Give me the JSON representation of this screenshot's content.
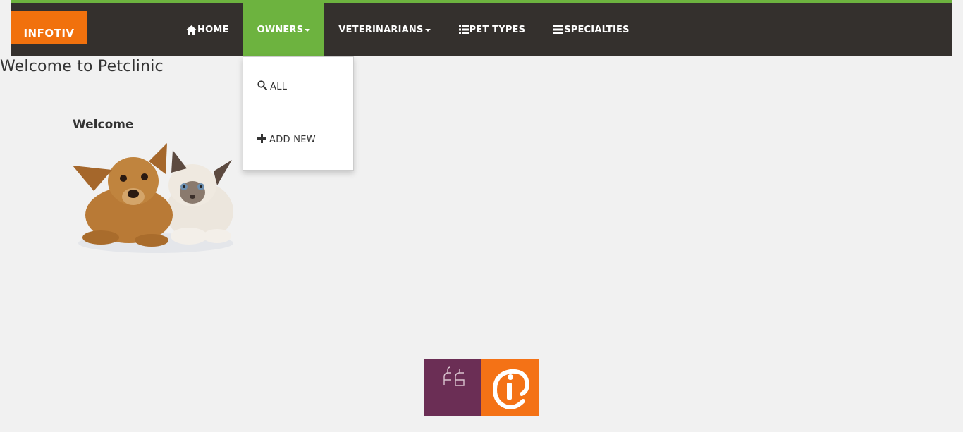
{
  "brand": {
    "label": "INFOTIV"
  },
  "nav": {
    "items": [
      {
        "label": "HOME",
        "icon": "home-icon"
      },
      {
        "label": "OWNERS",
        "icon": "caret-down-icon",
        "active": true
      },
      {
        "label": "VETERINARIANS",
        "icon": "caret-down-icon"
      },
      {
        "label": "PET TYPES",
        "icon": "list-icon"
      },
      {
        "label": "SPECIALTIES",
        "icon": "list-icon"
      }
    ]
  },
  "owners_dropdown": {
    "items": [
      {
        "label": "ALL",
        "icon": "search-icon"
      },
      {
        "label": "ADD NEW",
        "icon": "plus-icon"
      }
    ]
  },
  "page": {
    "heading": "Welcome to Petclinic",
    "welcome_title": "Welcome"
  },
  "colors": {
    "navbar_bg": "#34302d",
    "accent_green": "#6db33f",
    "brand_orange": "#f1710d",
    "ith_purple": "#6b2e55",
    "infotiv_orange": "#f47216"
  }
}
